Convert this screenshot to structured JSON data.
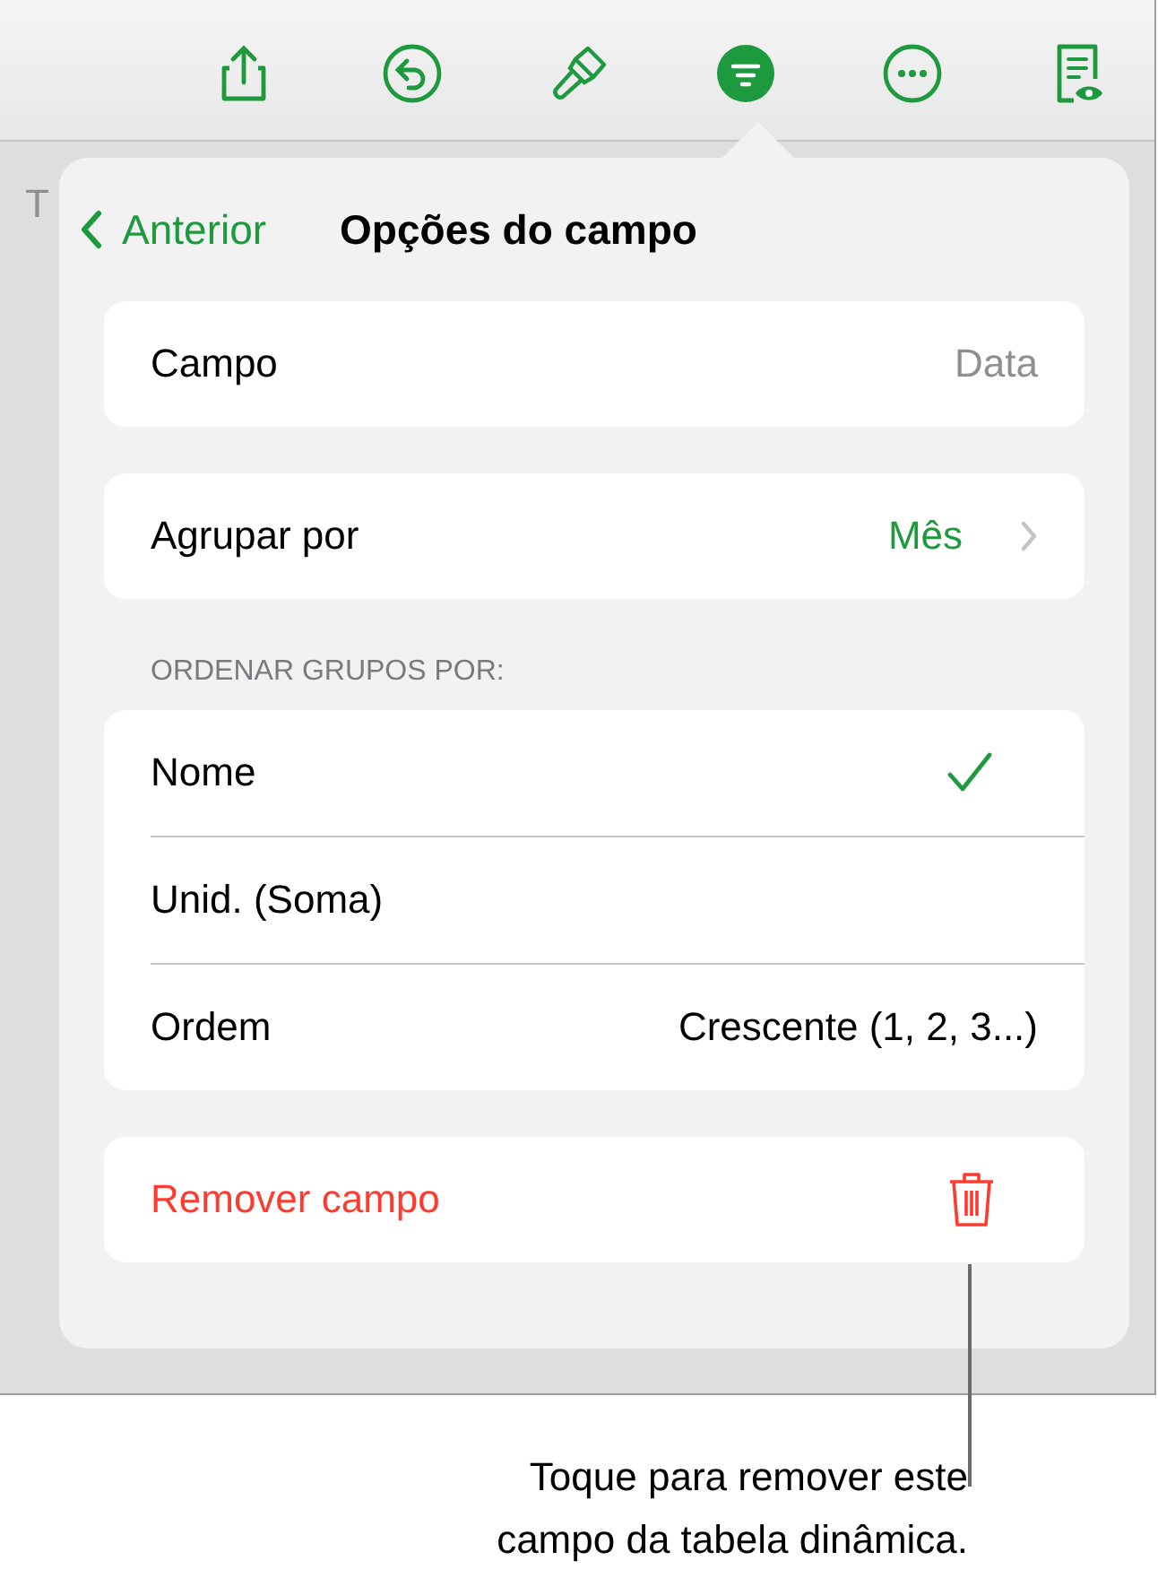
{
  "toolbar": {
    "buttons": [
      {
        "kind": "share",
        "selected": false
      },
      {
        "kind": "undo",
        "selected": false
      },
      {
        "kind": "brush",
        "selected": false
      },
      {
        "kind": "filter",
        "selected": true
      },
      {
        "kind": "more",
        "selected": false
      },
      {
        "kind": "preview",
        "selected": false
      }
    ]
  },
  "background_text": "T",
  "popover": {
    "back": "Anterior",
    "title": "Opções do campo",
    "groups": [
      {
        "rows": [
          {
            "kind": "value",
            "label": "Campo",
            "value": "Data"
          }
        ]
      },
      {
        "rows": [
          {
            "kind": "disclosure",
            "label": "Agrupar por",
            "value": "Mês"
          }
        ]
      },
      {
        "header": "ORDENAR GRUPOS POR:",
        "rows": [
          {
            "kind": "option",
            "label": "Nome",
            "selected": true
          },
          {
            "kind": "option",
            "label": "Unid. (Soma)",
            "selected": false
          },
          {
            "kind": "value",
            "label": "Ordem",
            "value": "Crescente (1, 2, 3...)"
          }
        ]
      },
      {
        "rows": [
          {
            "kind": "destructive",
            "label": "Remover campo"
          }
        ]
      }
    ]
  },
  "callout": "Toque para remover este\ncampo da tabela dinâmica."
}
